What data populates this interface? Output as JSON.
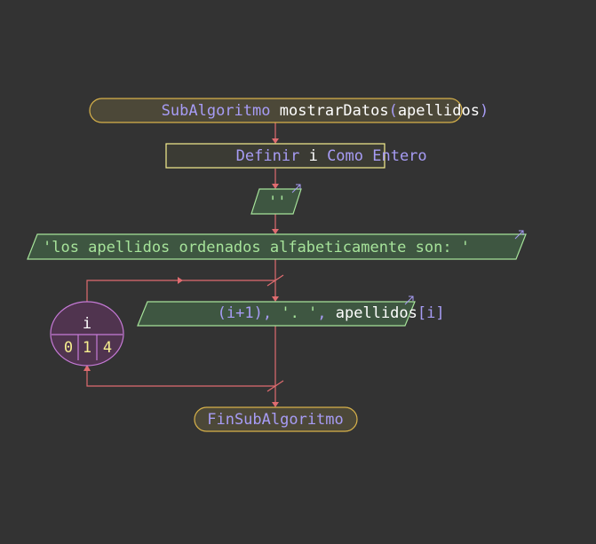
{
  "colors": {
    "background": "#333333",
    "flow_line": "#e06c70",
    "process_border": "#f6ee8f",
    "terminal_border": "#d8b24a",
    "io_fill": "#3e5641",
    "io_border": "#a6e39a",
    "loop_fill": "#50344f",
    "loop_border": "#c57ad6",
    "keyword": "#a79cf5",
    "identifier": "#ffffff",
    "string": "#a6e39a",
    "number": "#f6ee8f"
  },
  "diagram": {
    "start": {
      "keyword": "SubAlgoritmo",
      "name": "mostrarDatos",
      "paren_open": "(",
      "param": "apellidos",
      "paren_close": ")"
    },
    "define": {
      "kw_define": "Definir",
      "var": "i",
      "kw_as": "Como Entero"
    },
    "write_empty": {
      "text": "''"
    },
    "write_header": {
      "text": "'los apellidos ordenados alfabeticamente son: '"
    },
    "loop": {
      "var": "i",
      "start": "0",
      "step": "1",
      "end": "4"
    },
    "write_item": {
      "p1": "(i+1)",
      "p2": ",",
      "p3": " '. '",
      "p4": ",",
      "p5": " apellidos",
      "p6": "[i]"
    },
    "end": {
      "keyword": "FinSubAlgoritmo"
    }
  }
}
